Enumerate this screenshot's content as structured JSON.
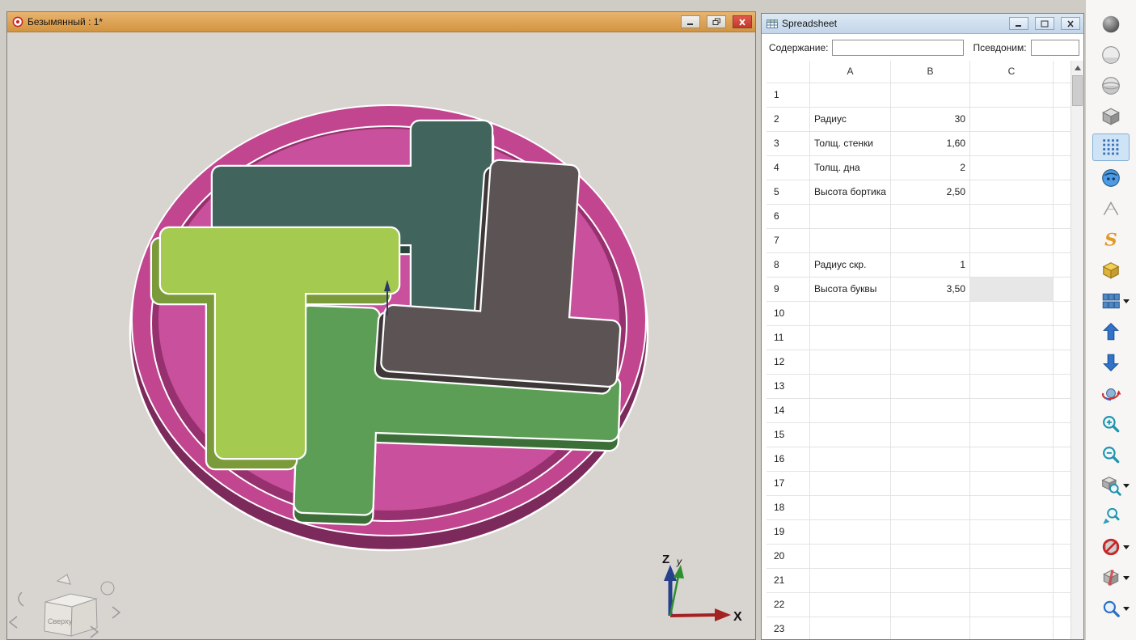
{
  "viewport_window": {
    "title": "Безымянный : 1*",
    "scene": {
      "nav_cube_label": "Сверху",
      "axis_labels": {
        "x": "X",
        "y": "y",
        "z": "Z"
      }
    }
  },
  "spreadsheet_window": {
    "title": "Spreadsheet",
    "form": {
      "content_label": "Содержание:",
      "content_value": "",
      "alias_label": "Псевдоним:",
      "alias_value": ""
    },
    "columns": [
      "A",
      "B",
      "C"
    ],
    "selected_cell": "C9",
    "rows": [
      {
        "n": "1",
        "A": "",
        "B": "",
        "C": ""
      },
      {
        "n": "2",
        "A": "Радиус",
        "B": "30",
        "C": ""
      },
      {
        "n": "3",
        "A": "Толщ. стенки",
        "B": "1,60",
        "C": ""
      },
      {
        "n": "4",
        "A": "Толщ. дна",
        "B": "2",
        "C": ""
      },
      {
        "n": "5",
        "A": "Высота бортика",
        "B": "2,50",
        "C": ""
      },
      {
        "n": "6",
        "A": "",
        "B": "",
        "C": ""
      },
      {
        "n": "7",
        "A": "",
        "B": "",
        "C": ""
      },
      {
        "n": "8",
        "A": "Радиус скр.",
        "B": "1",
        "C": ""
      },
      {
        "n": "9",
        "A": "Высота буквы",
        "B": "3,50",
        "C": ""
      },
      {
        "n": "10",
        "A": "",
        "B": "",
        "C": ""
      },
      {
        "n": "11",
        "A": "",
        "B": "",
        "C": ""
      },
      {
        "n": "12",
        "A": "",
        "B": "",
        "C": ""
      },
      {
        "n": "13",
        "A": "",
        "B": "",
        "C": ""
      },
      {
        "n": "14",
        "A": "",
        "B": "",
        "C": ""
      },
      {
        "n": "15",
        "A": "",
        "B": "",
        "C": ""
      },
      {
        "n": "16",
        "A": "",
        "B": "",
        "C": ""
      },
      {
        "n": "17",
        "A": "",
        "B": "",
        "C": ""
      },
      {
        "n": "18",
        "A": "",
        "B": "",
        "C": ""
      },
      {
        "n": "19",
        "A": "",
        "B": "",
        "C": ""
      },
      {
        "n": "20",
        "A": "",
        "B": "",
        "C": ""
      },
      {
        "n": "21",
        "A": "",
        "B": "",
        "C": ""
      },
      {
        "n": "22",
        "A": "",
        "B": "",
        "C": ""
      },
      {
        "n": "23",
        "A": "",
        "B": "",
        "C": ""
      }
    ]
  },
  "toolbar": {
    "sketch_glyph": "S",
    "icons": [
      "shaded-sphere",
      "flat-sphere",
      "wireframe-sphere",
      "box-view",
      "grid-view",
      "navigation-ball",
      "isometric-arc",
      "sketch-s",
      "part-box",
      "array-grid",
      "move-up",
      "move-down",
      "rotate-view",
      "zoom-in",
      "zoom-out",
      "zoom-fit",
      "zoom-selection",
      "stop-block",
      "clipping-box",
      "zoom-tool"
    ],
    "with_dropdown": [
      "array-grid",
      "zoom-fit",
      "stop-block",
      "clipping-box",
      "zoom-tool"
    ]
  },
  "colors": {
    "base_pink": "#c2458f",
    "base_floor": "#c9509c",
    "letter_teal": "#41655c",
    "letter_gray": "#5b5354",
    "letter_green": "#5d9e57",
    "letter_lime": "#a5ca50",
    "selection": "#e7e7e7"
  }
}
